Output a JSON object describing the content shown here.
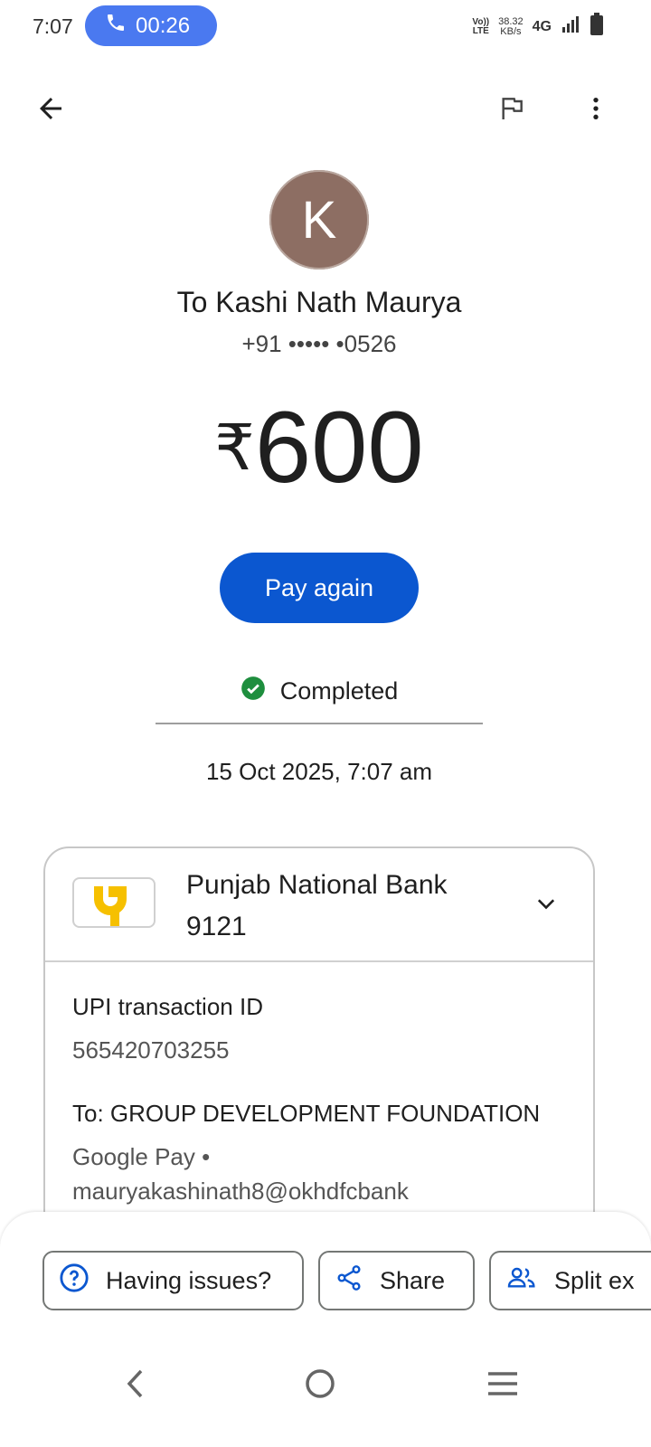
{
  "status_bar": {
    "time": "7:07",
    "call_timer": "00:26",
    "volte_top": "Vo))",
    "volte_bottom": "LTE",
    "speed_value": "38.32",
    "speed_unit": "KB/s",
    "network": "4G"
  },
  "header": {
    "back_icon": "arrow-back-icon",
    "flag_icon": "flag-icon",
    "more_icon": "more-vert-icon"
  },
  "recipient": {
    "avatar_letter": "K",
    "avatar_color": "#8d6e63",
    "name": "To Kashi Nath Maurya",
    "phone": "+91 ••••• •0526"
  },
  "payment": {
    "currency": "₹",
    "amount": "600",
    "pay_again_label": "Pay again",
    "status": "Completed",
    "status_color": "#1e8e3e",
    "datetime": "15 Oct 2025, 7:07 am"
  },
  "card": {
    "bank_name": "Punjab National Bank",
    "account_suffix": "9121",
    "txn_label": "UPI transaction ID",
    "txn_id": "565420703255",
    "to_label": "To: GROUP DEVELOPMENT FOUNDATION",
    "to_via": "Google Pay •",
    "to_upi": "mauryakashinath8@okhdfcbank"
  },
  "actions": [
    {
      "label": "Having issues?",
      "icon": "help-icon"
    },
    {
      "label": "Share",
      "icon": "share-icon"
    },
    {
      "label": "Split ex",
      "icon": "group-icon"
    }
  ],
  "colors": {
    "accent": "#0b57d0",
    "call_pill": "#4a79f0"
  }
}
